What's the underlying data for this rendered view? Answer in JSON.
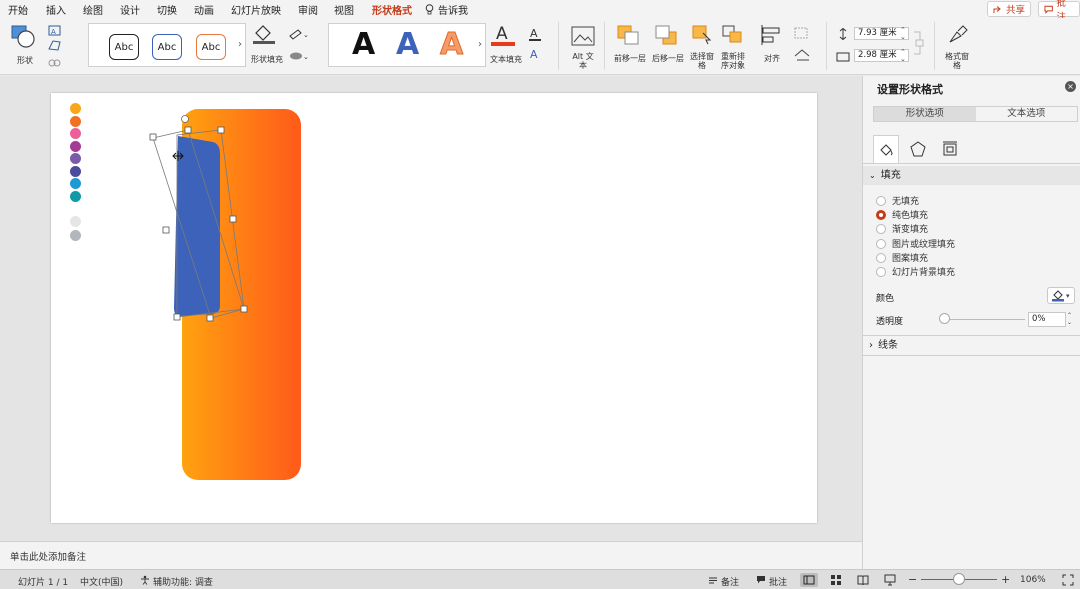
{
  "menu": {
    "tabs": [
      "开始",
      "插入",
      "绘图",
      "设计",
      "切换",
      "动画",
      "幻灯片放映",
      "审阅",
      "视图",
      "形状格式"
    ],
    "active_tab": "形状格式",
    "tell_me": "告诉我",
    "share_label": "共享",
    "comments_label": "批注"
  },
  "ribbon": {
    "shape_label": "形状",
    "style_samples": [
      "Abc",
      "Abc",
      "Abc"
    ],
    "shape_fill_label": "形状填充",
    "wordart_letter": "A",
    "text_fill_label": "文本填充",
    "alt_text_label": "Alt 文本",
    "bring_forward_label": "前移一层",
    "send_backward_label": "后移一层",
    "selection_pane_label": "选择窗格",
    "reorder_label": "重新排序对象",
    "align_label": "对齐",
    "height_value": "7.93 厘米",
    "width_value": "2.98 厘米",
    "format_pane_label": "格式窗格"
  },
  "slide": {
    "palette_colors": [
      "#f9a61a",
      "#f36f21",
      "#ee5f9a",
      "#a23c96",
      "#7b5ba8",
      "#4a4b9d",
      "#1c9ad6",
      "#119aa5",
      "#e6e6e6",
      "#b3b7bc"
    ],
    "gradient_colors": [
      "#ffa210",
      "#ff5a1a"
    ],
    "selected_shape_color": "#3d62b9"
  },
  "notes_placeholder": "单击此处添加备注",
  "pane": {
    "title": "设置形状格式",
    "tabs": [
      "形状选项",
      "文本选项"
    ],
    "fill_section": "填充",
    "fill_options": [
      "无填充",
      "纯色填充",
      "渐变填充",
      "图片或纹理填充",
      "图案填充",
      "幻灯片背景填充"
    ],
    "selected_fill": "纯色填充",
    "color_label": "颜色",
    "transparency_label": "透明度",
    "transparency_value": "0%",
    "line_section": "线条"
  },
  "status": {
    "slide_counter": "幻灯片 1 / 1",
    "language": "中文(中国)",
    "accessibility": "辅助功能: 调查",
    "notes_btn": "备注",
    "comments_btn": "批注",
    "zoom": "106%"
  },
  "colors": {
    "accent": "#c43c1c",
    "text_fill_red": "#e8391a",
    "wordart_blue": "#3d62b9",
    "wordart_orange": "#f59b6a"
  }
}
